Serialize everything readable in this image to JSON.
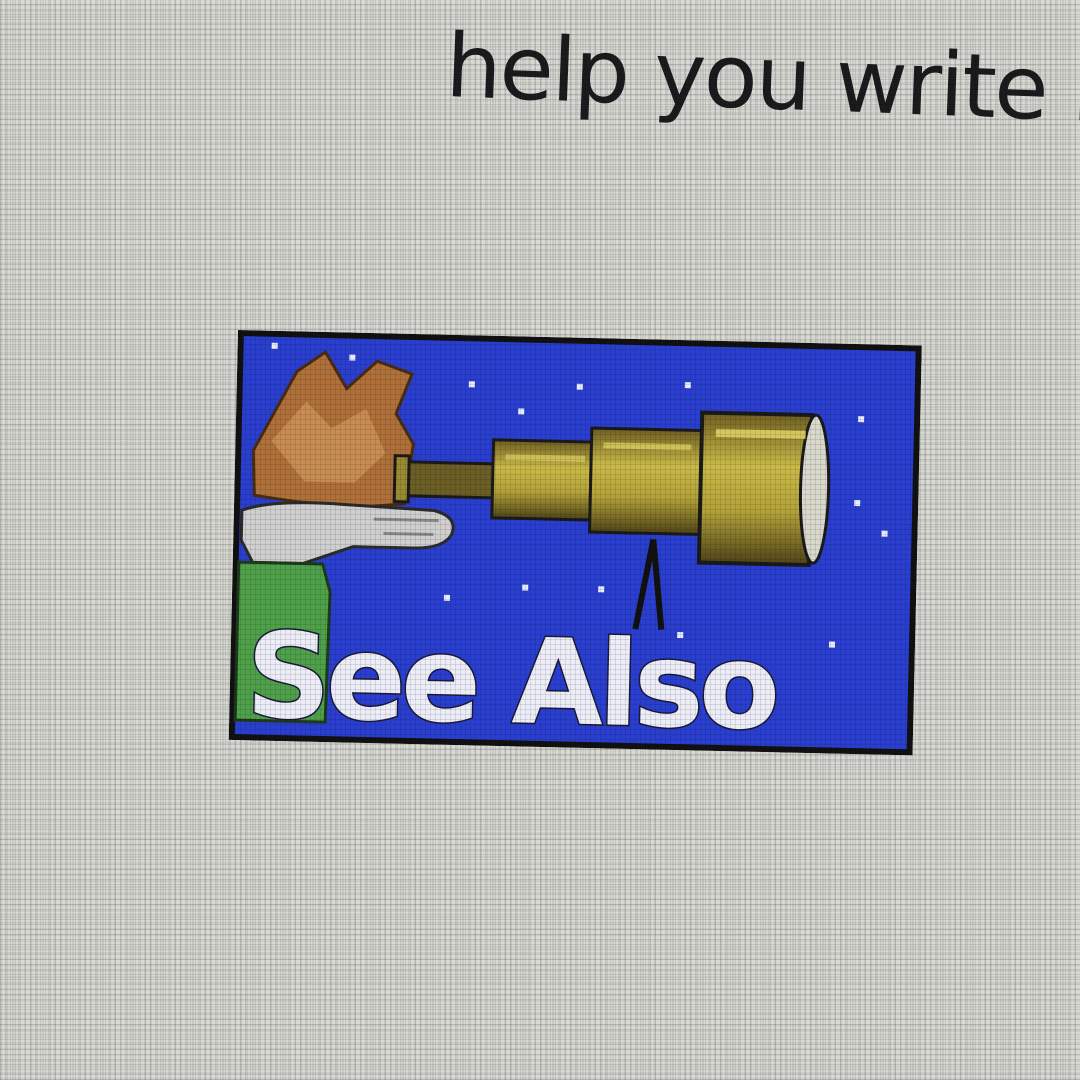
{
  "page": {
    "body_text_fragment": "help you write re"
  },
  "see_also_button": {
    "label": "See Also",
    "icon": "telescope-icon",
    "colors": {
      "background": "#2a3fd0",
      "border": "#111111",
      "label": "#ecedf7",
      "telescope": "#b3a23a",
      "hand": "#cfcfcf",
      "hair": "#b0703a",
      "sleeve": "#4fa04a"
    }
  }
}
